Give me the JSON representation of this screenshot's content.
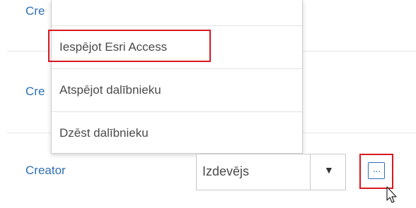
{
  "rows": [
    {
      "role_link": "Cre"
    },
    {
      "role_link": "Cre"
    },
    {
      "role_link": "Creator"
    }
  ],
  "menu": {
    "items": [
      {
        "label": "Iespējot Esri Access"
      },
      {
        "label": "Atspējot dalībnieku"
      },
      {
        "label": "Dzēst dalībnieku"
      }
    ]
  },
  "role_select": {
    "value": "Izdevējs",
    "arrow": "▼"
  },
  "more_button": {
    "glyph": "···",
    "icon": "ellipsis-icon"
  },
  "colors": {
    "link": "#2f6fb5",
    "highlight": "#d71920",
    "text": "#4a4a4a"
  }
}
